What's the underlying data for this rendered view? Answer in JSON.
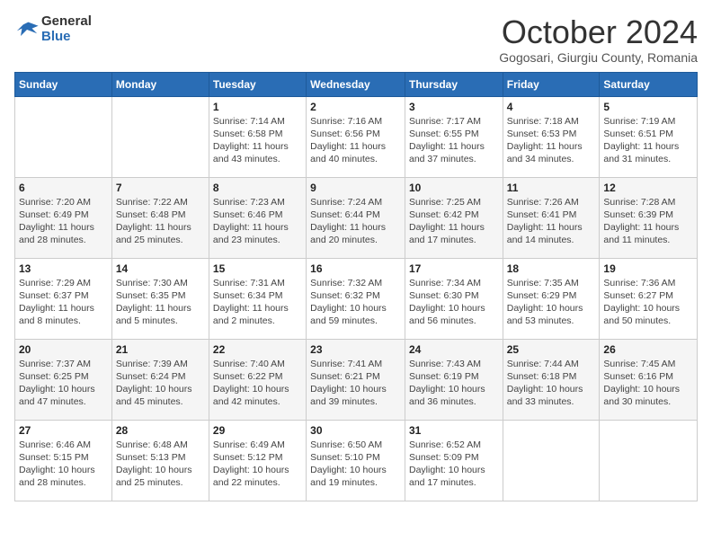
{
  "header": {
    "logo_general": "General",
    "logo_blue": "Blue",
    "month_title": "October 2024",
    "location": "Gogosari, Giurgiu County, Romania"
  },
  "days_of_week": [
    "Sunday",
    "Monday",
    "Tuesday",
    "Wednesday",
    "Thursday",
    "Friday",
    "Saturday"
  ],
  "weeks": [
    [
      {
        "day": "",
        "info": ""
      },
      {
        "day": "",
        "info": ""
      },
      {
        "day": "1",
        "info": "Sunrise: 7:14 AM\nSunset: 6:58 PM\nDaylight: 11 hours and 43 minutes."
      },
      {
        "day": "2",
        "info": "Sunrise: 7:16 AM\nSunset: 6:56 PM\nDaylight: 11 hours and 40 minutes."
      },
      {
        "day": "3",
        "info": "Sunrise: 7:17 AM\nSunset: 6:55 PM\nDaylight: 11 hours and 37 minutes."
      },
      {
        "day": "4",
        "info": "Sunrise: 7:18 AM\nSunset: 6:53 PM\nDaylight: 11 hours and 34 minutes."
      },
      {
        "day": "5",
        "info": "Sunrise: 7:19 AM\nSunset: 6:51 PM\nDaylight: 11 hours and 31 minutes."
      }
    ],
    [
      {
        "day": "6",
        "info": "Sunrise: 7:20 AM\nSunset: 6:49 PM\nDaylight: 11 hours and 28 minutes."
      },
      {
        "day": "7",
        "info": "Sunrise: 7:22 AM\nSunset: 6:48 PM\nDaylight: 11 hours and 25 minutes."
      },
      {
        "day": "8",
        "info": "Sunrise: 7:23 AM\nSunset: 6:46 PM\nDaylight: 11 hours and 23 minutes."
      },
      {
        "day": "9",
        "info": "Sunrise: 7:24 AM\nSunset: 6:44 PM\nDaylight: 11 hours and 20 minutes."
      },
      {
        "day": "10",
        "info": "Sunrise: 7:25 AM\nSunset: 6:42 PM\nDaylight: 11 hours and 17 minutes."
      },
      {
        "day": "11",
        "info": "Sunrise: 7:26 AM\nSunset: 6:41 PM\nDaylight: 11 hours and 14 minutes."
      },
      {
        "day": "12",
        "info": "Sunrise: 7:28 AM\nSunset: 6:39 PM\nDaylight: 11 hours and 11 minutes."
      }
    ],
    [
      {
        "day": "13",
        "info": "Sunrise: 7:29 AM\nSunset: 6:37 PM\nDaylight: 11 hours and 8 minutes."
      },
      {
        "day": "14",
        "info": "Sunrise: 7:30 AM\nSunset: 6:35 PM\nDaylight: 11 hours and 5 minutes."
      },
      {
        "day": "15",
        "info": "Sunrise: 7:31 AM\nSunset: 6:34 PM\nDaylight: 11 hours and 2 minutes."
      },
      {
        "day": "16",
        "info": "Sunrise: 7:32 AM\nSunset: 6:32 PM\nDaylight: 10 hours and 59 minutes."
      },
      {
        "day": "17",
        "info": "Sunrise: 7:34 AM\nSunset: 6:30 PM\nDaylight: 10 hours and 56 minutes."
      },
      {
        "day": "18",
        "info": "Sunrise: 7:35 AM\nSunset: 6:29 PM\nDaylight: 10 hours and 53 minutes."
      },
      {
        "day": "19",
        "info": "Sunrise: 7:36 AM\nSunset: 6:27 PM\nDaylight: 10 hours and 50 minutes."
      }
    ],
    [
      {
        "day": "20",
        "info": "Sunrise: 7:37 AM\nSunset: 6:25 PM\nDaylight: 10 hours and 47 minutes."
      },
      {
        "day": "21",
        "info": "Sunrise: 7:39 AM\nSunset: 6:24 PM\nDaylight: 10 hours and 45 minutes."
      },
      {
        "day": "22",
        "info": "Sunrise: 7:40 AM\nSunset: 6:22 PM\nDaylight: 10 hours and 42 minutes."
      },
      {
        "day": "23",
        "info": "Sunrise: 7:41 AM\nSunset: 6:21 PM\nDaylight: 10 hours and 39 minutes."
      },
      {
        "day": "24",
        "info": "Sunrise: 7:43 AM\nSunset: 6:19 PM\nDaylight: 10 hours and 36 minutes."
      },
      {
        "day": "25",
        "info": "Sunrise: 7:44 AM\nSunset: 6:18 PM\nDaylight: 10 hours and 33 minutes."
      },
      {
        "day": "26",
        "info": "Sunrise: 7:45 AM\nSunset: 6:16 PM\nDaylight: 10 hours and 30 minutes."
      }
    ],
    [
      {
        "day": "27",
        "info": "Sunrise: 6:46 AM\nSunset: 5:15 PM\nDaylight: 10 hours and 28 minutes."
      },
      {
        "day": "28",
        "info": "Sunrise: 6:48 AM\nSunset: 5:13 PM\nDaylight: 10 hours and 25 minutes."
      },
      {
        "day": "29",
        "info": "Sunrise: 6:49 AM\nSunset: 5:12 PM\nDaylight: 10 hours and 22 minutes."
      },
      {
        "day": "30",
        "info": "Sunrise: 6:50 AM\nSunset: 5:10 PM\nDaylight: 10 hours and 19 minutes."
      },
      {
        "day": "31",
        "info": "Sunrise: 6:52 AM\nSunset: 5:09 PM\nDaylight: 10 hours and 17 minutes."
      },
      {
        "day": "",
        "info": ""
      },
      {
        "day": "",
        "info": ""
      }
    ]
  ]
}
